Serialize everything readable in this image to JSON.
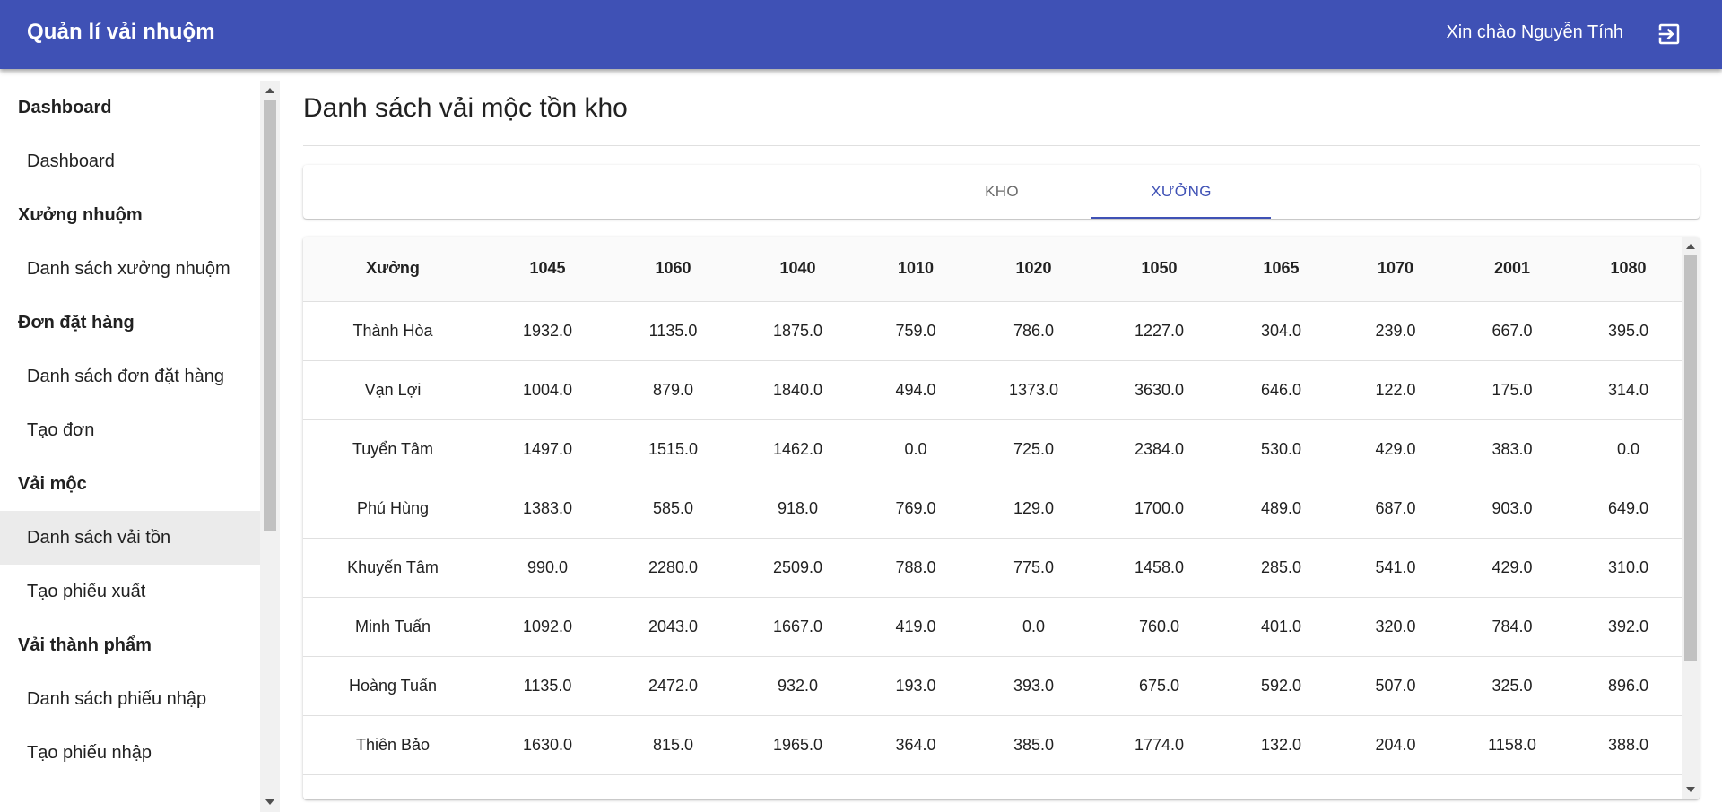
{
  "app": {
    "title": "Quản lí vải nhuộm",
    "greeting": "Xin chào Nguyễn Tính",
    "logout_icon": "logout-icon",
    "brand_color": "#3f51b5"
  },
  "sidebar": {
    "groups": [
      {
        "label": "Dashboard",
        "items": [
          {
            "label": "Dashboard",
            "active": false
          }
        ]
      },
      {
        "label": "Xưởng nhuộm",
        "items": [
          {
            "label": "Danh sách xưởng nhuộm",
            "active": false
          }
        ]
      },
      {
        "label": "Đơn đặt hàng",
        "items": [
          {
            "label": "Danh sách đơn đặt hàng",
            "active": false
          },
          {
            "label": "Tạo đơn",
            "active": false
          }
        ]
      },
      {
        "label": "Vải mộc",
        "items": [
          {
            "label": "Danh sách vải tồn",
            "active": true
          },
          {
            "label": "Tạo phiếu xuất",
            "active": false
          }
        ]
      },
      {
        "label": "Vải thành phẩm",
        "items": [
          {
            "label": "Danh sách phiếu nhập",
            "active": false
          },
          {
            "label": "Tạo phiếu nhập",
            "active": false
          }
        ]
      }
    ]
  },
  "main": {
    "title": "Danh sách vải mộc tồn kho",
    "tabs": [
      {
        "label": "KHO",
        "selected": false
      },
      {
        "label": "XƯỞNG",
        "selected": true
      }
    ]
  },
  "table": {
    "headers": [
      "Xưởng",
      "1045",
      "1060",
      "1040",
      "1010",
      "1020",
      "1050",
      "1065",
      "1070",
      "2001",
      "1080"
    ],
    "rows": [
      [
        "Thành Hòa",
        "1932.0",
        "1135.0",
        "1875.0",
        "759.0",
        "786.0",
        "1227.0",
        "304.0",
        "239.0",
        "667.0",
        "395.0"
      ],
      [
        "Vạn Lợi",
        "1004.0",
        "879.0",
        "1840.0",
        "494.0",
        "1373.0",
        "3630.0",
        "646.0",
        "122.0",
        "175.0",
        "314.0"
      ],
      [
        "Tuyển Tâm",
        "1497.0",
        "1515.0",
        "1462.0",
        "0.0",
        "725.0",
        "2384.0",
        "530.0",
        "429.0",
        "383.0",
        "0.0"
      ],
      [
        "Phú Hùng",
        "1383.0",
        "585.0",
        "918.0",
        "769.0",
        "129.0",
        "1700.0",
        "489.0",
        "687.0",
        "903.0",
        "649.0"
      ],
      [
        "Khuyến Tâm",
        "990.0",
        "2280.0",
        "2509.0",
        "788.0",
        "775.0",
        "1458.0",
        "285.0",
        "541.0",
        "429.0",
        "310.0"
      ],
      [
        "Minh Tuấn",
        "1092.0",
        "2043.0",
        "1667.0",
        "419.0",
        "0.0",
        "760.0",
        "401.0",
        "320.0",
        "784.0",
        "392.0"
      ],
      [
        "Hoàng Tuấn",
        "1135.0",
        "2472.0",
        "932.0",
        "193.0",
        "393.0",
        "675.0",
        "592.0",
        "507.0",
        "325.0",
        "896.0"
      ],
      [
        "Thiên Bảo",
        "1630.0",
        "815.0",
        "1965.0",
        "364.0",
        "385.0",
        "1774.0",
        "132.0",
        "204.0",
        "1158.0",
        "388.0"
      ]
    ]
  }
}
